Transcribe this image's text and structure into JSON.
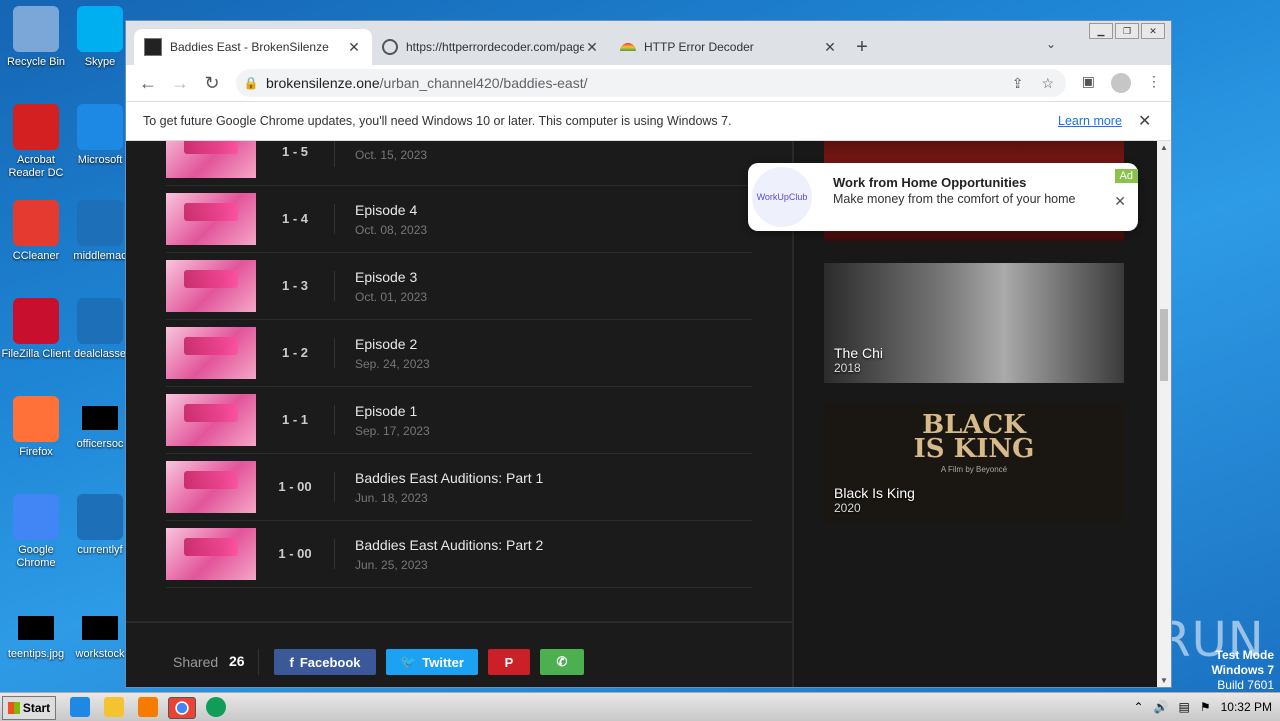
{
  "desktop": {
    "icons_col1": [
      {
        "label": "Recycle Bin",
        "color": "#7aa7d8"
      },
      {
        "label": "Acrobat Reader DC",
        "color": "#d42020"
      },
      {
        "label": "CCleaner",
        "color": "#e53a2f"
      },
      {
        "label": "FileZilla Client",
        "color": "#c8102e"
      },
      {
        "label": "Firefox",
        "color": "#ff7139"
      },
      {
        "label": "Google Chrome",
        "color": "#4285f4"
      },
      {
        "label": "teentips.jpg",
        "color": "#000000"
      }
    ],
    "icons_col2": [
      {
        "label": "Skype",
        "color": "#00aff0"
      },
      {
        "label": "Microsoft",
        "color": "#1e88e5"
      },
      {
        "label": "middlemac",
        "color": "#1d6fb8"
      },
      {
        "label": "dealclasse",
        "color": "#1d6fb8"
      },
      {
        "label": "officersoc",
        "color": "#000000"
      },
      {
        "label": "currentlyf",
        "color": "#1d6fb8"
      },
      {
        "label": "workstock",
        "color": "#000000"
      }
    ],
    "watermark": "ANY RUN",
    "testmode": {
      "line1": "Test Mode",
      "line2": "Windows 7",
      "line3": "Build 7601"
    }
  },
  "browser": {
    "tabs": [
      {
        "title": "Baddies East - BrokenSilenze",
        "active": true
      },
      {
        "title": "https://httperrordecoder.com/page/",
        "active": false
      },
      {
        "title": "HTTP Error Decoder",
        "active": false
      }
    ],
    "url_host": "brokensilenze.one",
    "url_path": "/urban_channel420/baddies-east/",
    "infobar": {
      "message": "To get future Google Chrome updates, you'll need Windows 10 or later. This computer is using Windows 7.",
      "link": "Learn more"
    }
  },
  "episodes": [
    {
      "num": "1 - 5",
      "title": "",
      "date": "Oct. 15, 2023"
    },
    {
      "num": "1 - 4",
      "title": "Episode 4",
      "date": "Oct. 08, 2023"
    },
    {
      "num": "1 - 3",
      "title": "Episode 3",
      "date": "Oct. 01, 2023"
    },
    {
      "num": "1 - 2",
      "title": "Episode 2",
      "date": "Sep. 24, 2023"
    },
    {
      "num": "1 - 1",
      "title": "Episode 1",
      "date": "Sep. 17, 2023"
    },
    {
      "num": "1 - 00",
      "title": "Baddies East Auditions: Part 1",
      "date": "Jun. 18, 2023"
    },
    {
      "num": "1 - 00",
      "title": "Baddies East Auditions: Part 2",
      "date": "Jun. 25, 2023"
    }
  ],
  "share": {
    "label": "Shared",
    "count": "26",
    "facebook": "Facebook",
    "twitter": "Twitter",
    "colors": {
      "facebook": "#3b5998",
      "twitter": "#1da1f2",
      "pinterest": "#cb2027",
      "whatsapp": "#4caf50"
    }
  },
  "sidebar": {
    "posters": [
      {
        "title": "The Chi",
        "year": "2018"
      },
      {
        "title": "Black Is King",
        "year": "2020",
        "art_text": "BLACK IS KING",
        "art_sub": "A Film by Beyoncé"
      }
    ]
  },
  "ad": {
    "badge": "Ad",
    "logo_text": "WorkUpClub",
    "headline": "Work from Home Opportunities",
    "description": "Make money from the comfort of your home"
  },
  "taskbar": {
    "start": "Start",
    "clock": "10:32 PM"
  }
}
